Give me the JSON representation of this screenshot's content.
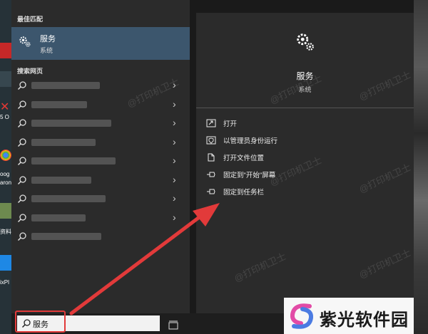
{
  "desktop": {
    "labels": [
      "oog",
      "aron",
      "资料",
      "ixPl",
      "5 O"
    ]
  },
  "start_menu": {
    "best_match_label": "最佳匹配",
    "best_match": {
      "title": "服务",
      "subtitle": "系统",
      "icon": "gears-icon"
    },
    "web_label": "搜索网页",
    "web_results_count": 9
  },
  "detail_panel": {
    "title": "服务",
    "subtitle": "系统",
    "icon": "gears-icon",
    "actions": [
      {
        "label": "打开",
        "icon": "open-icon"
      },
      {
        "label": "以管理员身份运行",
        "icon": "admin-shield-icon"
      },
      {
        "label": "打开文件位置",
        "icon": "file-location-icon"
      },
      {
        "label": "固定到\"开始\"屏幕",
        "icon": "pin-start-icon"
      },
      {
        "label": "固定到任务栏",
        "icon": "pin-taskbar-icon"
      }
    ]
  },
  "taskbar": {
    "search_value": "服务"
  },
  "colors": {
    "panel_bg": "#2b2b2b",
    "highlight_bg": "#3c566d",
    "annotation_red": "#e23a3a"
  },
  "watermark": {
    "text": "@打印机卫士"
  },
  "brand": {
    "name": "紫光软件园"
  }
}
